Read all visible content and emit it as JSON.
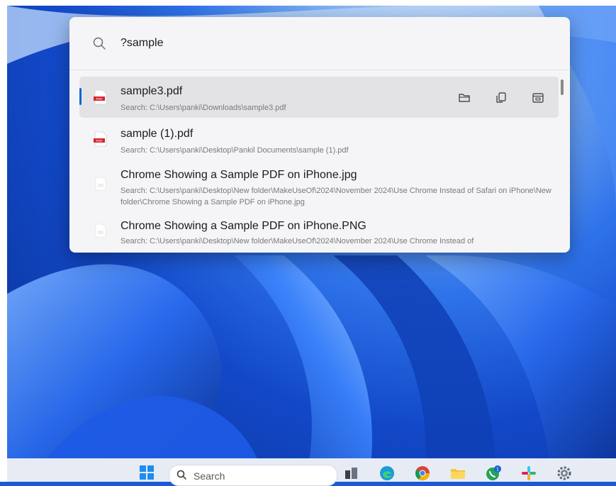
{
  "search": {
    "query": "?sample",
    "icon": "search-icon"
  },
  "results": [
    {
      "title": "sample3.pdf",
      "subtitle": "Search: C:\\Users\\panki\\Downloads\\sample3.pdf",
      "icon": "pdf-file-icon",
      "selected": true
    },
    {
      "title": "sample (1).pdf",
      "subtitle": "Search: C:\\Users\\panki\\Desktop\\Pankil Documents\\sample (1).pdf",
      "icon": "pdf-file-icon"
    },
    {
      "title": "Chrome Showing a Sample PDF on iPhone.jpg",
      "subtitle": "Search: C:\\Users\\panki\\Desktop\\New folder\\MakeUseOf\\2024\\November 2024\\Use Chrome Instead of Safari on iPhone\\New folder\\Chrome Showing a Sample PDF on iPhone.jpg",
      "icon": "image-file-icon"
    },
    {
      "title": "Chrome Showing a Sample PDF on iPhone.PNG",
      "subtitle": "Search: C:\\Users\\panki\\Desktop\\New folder\\MakeUseOf\\2024\\November 2024\\Use Chrome Instead of",
      "icon": "image-file-icon"
    }
  ],
  "actions": [
    "open-folder-icon",
    "copy-path-icon",
    "open-console-icon"
  ],
  "taskbar": {
    "search_label": "Search",
    "apps": [
      "file-explorer-icon",
      "edge-icon",
      "chrome-icon",
      "folder-icon",
      "whatsapp-icon",
      "slack-icon",
      "settings-icon"
    ],
    "whatsapp_badge": "1"
  },
  "colors": {
    "accent": "#1463d6",
    "pdf_red": "#d7262e"
  }
}
